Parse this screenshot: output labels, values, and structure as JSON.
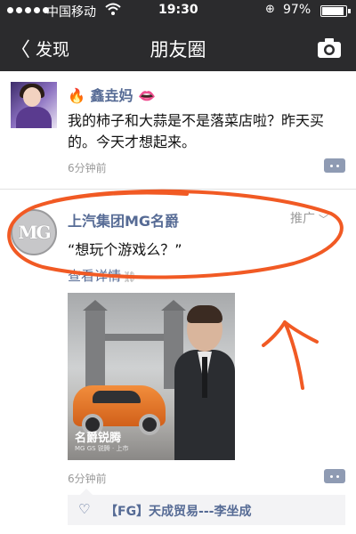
{
  "status_bar": {
    "carrier": "中国移动",
    "time": "19:30",
    "battery": "97%",
    "battery_level": 0.97
  },
  "nav": {
    "back_label": "发现",
    "title": "朋友圈"
  },
  "icons": {
    "back": "chevron-left-icon",
    "camera": "camera-icon",
    "comment": "comment-icon",
    "heart": "heart-icon",
    "link": "link-icon",
    "chevron": "chevron-down-icon"
  },
  "colors": {
    "nav_bg": "#2b2b2d",
    "name_link": "#566b95",
    "annotation": "#f15a24"
  },
  "posts": [
    {
      "name": "鑫垚妈",
      "name_prefix_emoji": "🔥",
      "name_suffix_emoji": "👄",
      "text": "我的柿子和大蒜是不是落菜店啦？昨天买的。今天才想起来。",
      "time": "6分钟前"
    },
    {
      "name": "上汽集团MG名爵",
      "promo_label": "推广",
      "text": "“想玩个游戏么？”",
      "details_label": "查看详情",
      "ad_image": {
        "slogan": "名爵锐腾",
        "slogan_sub": "MG GS 锐腾 · 上市"
      },
      "time": "6分钟前",
      "likes": [
        "【FG】天成贸易---李坐成"
      ]
    }
  ]
}
